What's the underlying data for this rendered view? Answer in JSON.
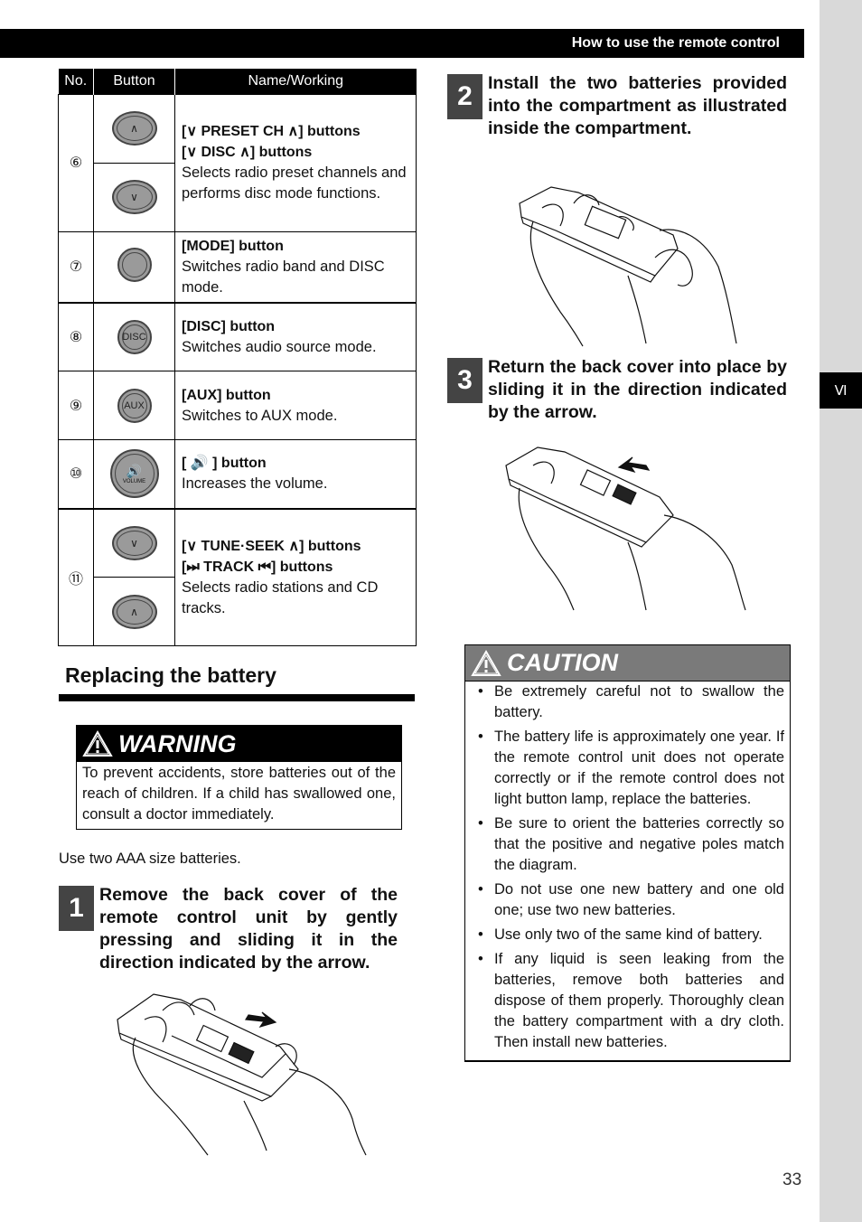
{
  "header": {
    "title": "How to use the remote control"
  },
  "side_tab": {
    "label": "Ⅵ"
  },
  "table": {
    "headers": [
      "No.",
      "Button",
      "Name/Working"
    ],
    "rows": [
      {
        "no": "⑥",
        "buttons": [
          "up-oval",
          "down-oval"
        ],
        "titles": [
          "[∨  PRESET CH  ∧] buttons",
          "[∨  DISC  ∧] buttons"
        ],
        "text": "Selects radio preset channels and performs disc mode functions."
      },
      {
        "no": "⑦",
        "buttons": [
          "mode-round"
        ],
        "titles": [
          "[MODE] button"
        ],
        "text": "Switches radio band and DISC mode."
      },
      {
        "no": "⑧",
        "buttons": [
          "disc-round"
        ],
        "button_label": "DISC",
        "titles": [
          "[DISC] button"
        ],
        "text": "Switches audio source mode."
      },
      {
        "no": "⑨",
        "buttons": [
          "aux-round"
        ],
        "button_label": "AUX",
        "titles": [
          "[AUX] button"
        ],
        "text": "Switches to AUX mode."
      },
      {
        "no": "⑩",
        "buttons": [
          "volume-round"
        ],
        "button_label": "VOLUME",
        "button_glyph": "🔊",
        "titles": [
          "[ 🔊 ] button"
        ],
        "text": "Increases the volume."
      },
      {
        "no": "⑪",
        "buttons": [
          "down-oval",
          "up-oval"
        ],
        "titles": [
          "[∨  TUNE·SEEK  ∧] buttons",
          "[⏭  TRACK  ⏮] buttons"
        ],
        "text": "Selects radio stations and CD tracks."
      }
    ]
  },
  "section": {
    "title": "Replacing the battery"
  },
  "warning": {
    "title": "WARNING",
    "text": "To prevent accidents, store batteries out of the reach of children. If a child has swallowed one, consult a doctor immediately."
  },
  "use_text": "Use two AAA size batteries.",
  "steps": [
    {
      "num": "1",
      "text": "Remove the back cover of the remote control unit by gently pressing and sliding it in the direction indicated by the arrow."
    },
    {
      "num": "2",
      "text": "Install the two batteries provided into the compartment as illustrated inside the compartment."
    },
    {
      "num": "3",
      "text": "Return the back cover into place by sliding it in the direction indicated by the arrow."
    }
  ],
  "caution": {
    "title": "CAUTION",
    "items": [
      "Be extremely careful not to swallow the battery.",
      "The battery life is approximately one year. If the remote control unit does not operate correctly or if the remote control does not light button lamp, replace the batteries.",
      "Be sure to orient the batteries correctly so that the positive and negative poles match the diagram.",
      "Do not use one new battery and one old one; use two new batteries.",
      "Use only two of the same kind of battery.",
      "If any liquid is seen leaking from the batteries, remove both batteries and dispose of them properly. Thoroughly clean the battery compartment with a dry cloth. Then install new batteries."
    ]
  },
  "page_number": "33"
}
